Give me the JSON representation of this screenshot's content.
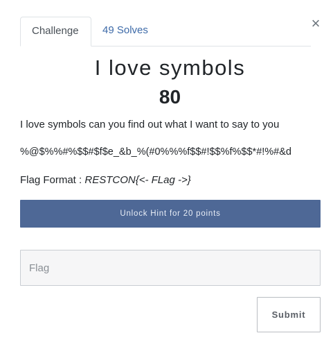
{
  "tabs": [
    {
      "label": "Challenge"
    },
    {
      "label": "49 Solves"
    }
  ],
  "close_label": "×",
  "challenge": {
    "name": "I love symbols",
    "value": "80",
    "description": "I love symbols can you find out what I want to say to you",
    "cipher_text": "%@$%%#%$$#$f$e_&b_%(#0%%%f$$#!$$%f%$$*#!%#&d",
    "flag_format_label": "Flag Format : ",
    "flag_format_value": "RESTCON{<- FLag ->}"
  },
  "hint_button_label": "Unlock Hint for 20 points",
  "flag_input": {
    "placeholder": "Flag",
    "value": ""
  },
  "submit_label": "Submit",
  "colors": {
    "hint_button_bg": "#4e6896",
    "link": "#3d6aa8"
  }
}
